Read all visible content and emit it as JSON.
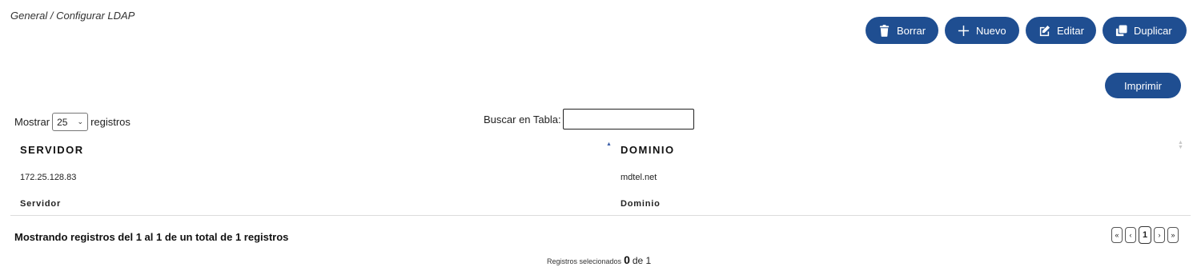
{
  "breadcrumb": "General / Configurar LDAP",
  "toolbar": {
    "borrar": "Borrar",
    "nuevo": "Nuevo",
    "editar": "Editar",
    "duplicar": "Duplicar",
    "imprimir": "Imprimir"
  },
  "length": {
    "prefix": "Mostrar",
    "value": "25",
    "suffix": "registros"
  },
  "search": {
    "label": "Buscar en Tabla:",
    "value": ""
  },
  "table": {
    "headers": [
      "SERVIDOR",
      "DOMINIO"
    ],
    "rows": [
      [
        "172.25.128.83",
        "mdtel.net"
      ]
    ],
    "footers": [
      "Servidor",
      "Dominio"
    ],
    "sort": {
      "column": "SERVIDOR",
      "direction": "asc"
    }
  },
  "info": "Mostrando registros del 1 al 1 de un total de 1 registros",
  "pagination": {
    "first": "«",
    "prev": "‹",
    "current": "1",
    "next": "›",
    "last": "»"
  },
  "selection": {
    "label": "Registros selecionados",
    "count": "0",
    "of": "de 1"
  },
  "colors": {
    "button": "#1f4e91",
    "sort_active": "#3c5ea8"
  }
}
